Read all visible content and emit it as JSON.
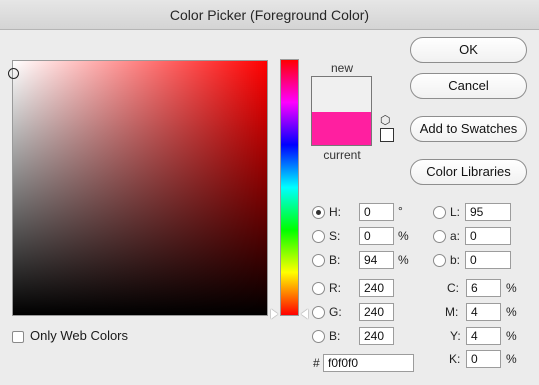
{
  "window": {
    "title": "Color Picker (Foreground Color)"
  },
  "swatch": {
    "new_label": "new",
    "current_label": "current",
    "new_color": "#f0f0f0",
    "current_color": "#ff1fa0"
  },
  "buttons": {
    "ok": "OK",
    "cancel": "Cancel",
    "add_to_swatches": "Add to Swatches",
    "color_libraries": "Color Libraries"
  },
  "hsb": {
    "h_label": "H:",
    "h_value": "0",
    "h_unit": "°",
    "s_label": "S:",
    "s_value": "0",
    "s_unit": "%",
    "b_label": "B:",
    "b_value": "94",
    "b_unit": "%"
  },
  "rgb": {
    "r_label": "R:",
    "r_value": "240",
    "g_label": "G:",
    "g_value": "240",
    "b_label": "B:",
    "b_value": "240"
  },
  "lab": {
    "l_label": "L:",
    "l_value": "95",
    "a_label": "a:",
    "a_value": "0",
    "b_label": "b:",
    "b_value": "0"
  },
  "cmyk": {
    "c_label": "C:",
    "c_value": "6",
    "m_label": "M:",
    "m_value": "4",
    "y_label": "Y:",
    "y_value": "4",
    "k_label": "K:",
    "k_value": "0",
    "unit": "%"
  },
  "hex": {
    "label": "#",
    "value": "f0f0f0"
  },
  "options": {
    "only_web_colors_label": "Only Web Colors",
    "only_web_colors_checked": false
  },
  "icons": {
    "cube": "cube-icon"
  }
}
